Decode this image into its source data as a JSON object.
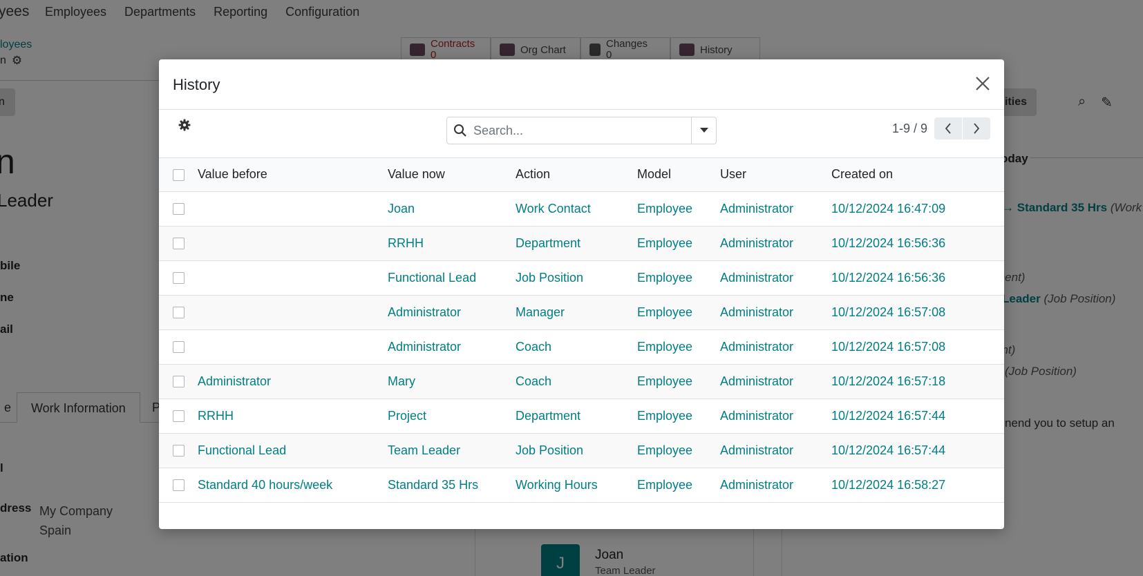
{
  "background": {
    "app_name": "yees",
    "menu": [
      "Employees",
      "Departments",
      "Reporting",
      "Configuration"
    ],
    "breadcrumb_parent": "loyees",
    "breadcrumb_current": "n",
    "left_button": "n",
    "smart_buttons": [
      {
        "label": "Contracts",
        "count": "0"
      },
      {
        "label": "Org Chart",
        "count": ""
      },
      {
        "label": "Changes",
        "count": "0"
      },
      {
        "label": "History",
        "count": ""
      }
    ],
    "employee_name": "n",
    "employee_job": "Leader",
    "field_labels": [
      "bile",
      "ne",
      "ail"
    ],
    "tabs": [
      "e",
      "Work Information",
      "P"
    ],
    "address_label": "dress",
    "address_lines": [
      "My Company",
      "Spain"
    ],
    "location_label": "ation",
    "tab_sub": "l",
    "org_avatar": "J",
    "org_name": "Joan",
    "org_role": "Team Leader",
    "chatter_button": "ities",
    "chatter_today": "oday",
    "chatter_lines": [
      {
        "text": "Standard 35 Hrs",
        "em": "(Work"
      },
      {
        "text": "",
        "em": "ment)"
      },
      {
        "text": "Leader",
        "em": "(Job Position)"
      },
      {
        "text": "",
        "em": "ent)"
      },
      {
        "text": "",
        "em": "(Job Position)"
      },
      {
        "text": "nend you to setup an",
        "em": ""
      }
    ]
  },
  "modal": {
    "title": "History",
    "search_placeholder": "Search...",
    "pager": "1-9 / 9",
    "columns": [
      "Value before",
      "Value now",
      "Action",
      "Model",
      "User",
      "Created on"
    ],
    "rows": [
      {
        "before": "",
        "now": "Joan",
        "action": "Work Contact",
        "model": "Employee",
        "user": "Administrator",
        "created": "10/12/2024 16:47:09"
      },
      {
        "before": "",
        "now": "RRHH",
        "action": "Department",
        "model": "Employee",
        "user": "Administrator",
        "created": "10/12/2024 16:56:36"
      },
      {
        "before": "",
        "now": "Functional Lead",
        "action": "Job Position",
        "model": "Employee",
        "user": "Administrator",
        "created": "10/12/2024 16:56:36"
      },
      {
        "before": "",
        "now": "Administrator",
        "action": "Manager",
        "model": "Employee",
        "user": "Administrator",
        "created": "10/12/2024 16:57:08"
      },
      {
        "before": "",
        "now": "Administrator",
        "action": "Coach",
        "model": "Employee",
        "user": "Administrator",
        "created": "10/12/2024 16:57:08"
      },
      {
        "before": "Administrator",
        "now": "Mary",
        "action": "Coach",
        "model": "Employee",
        "user": "Administrator",
        "created": "10/12/2024 16:57:18"
      },
      {
        "before": "RRHH",
        "now": "Project",
        "action": "Department",
        "model": "Employee",
        "user": "Administrator",
        "created": "10/12/2024 16:57:44"
      },
      {
        "before": "Functional Lead",
        "now": "Team Leader",
        "action": "Job Position",
        "model": "Employee",
        "user": "Administrator",
        "created": "10/12/2024 16:57:44"
      },
      {
        "before": "Standard 40 hours/week",
        "now": "Standard 35 Hrs",
        "action": "Working Hours",
        "model": "Employee",
        "user": "Administrator",
        "created": "10/12/2024 16:58:27"
      }
    ]
  },
  "colors": {
    "accent": "#017e84",
    "overlay": "rgba(0,0,0,0.5)"
  }
}
